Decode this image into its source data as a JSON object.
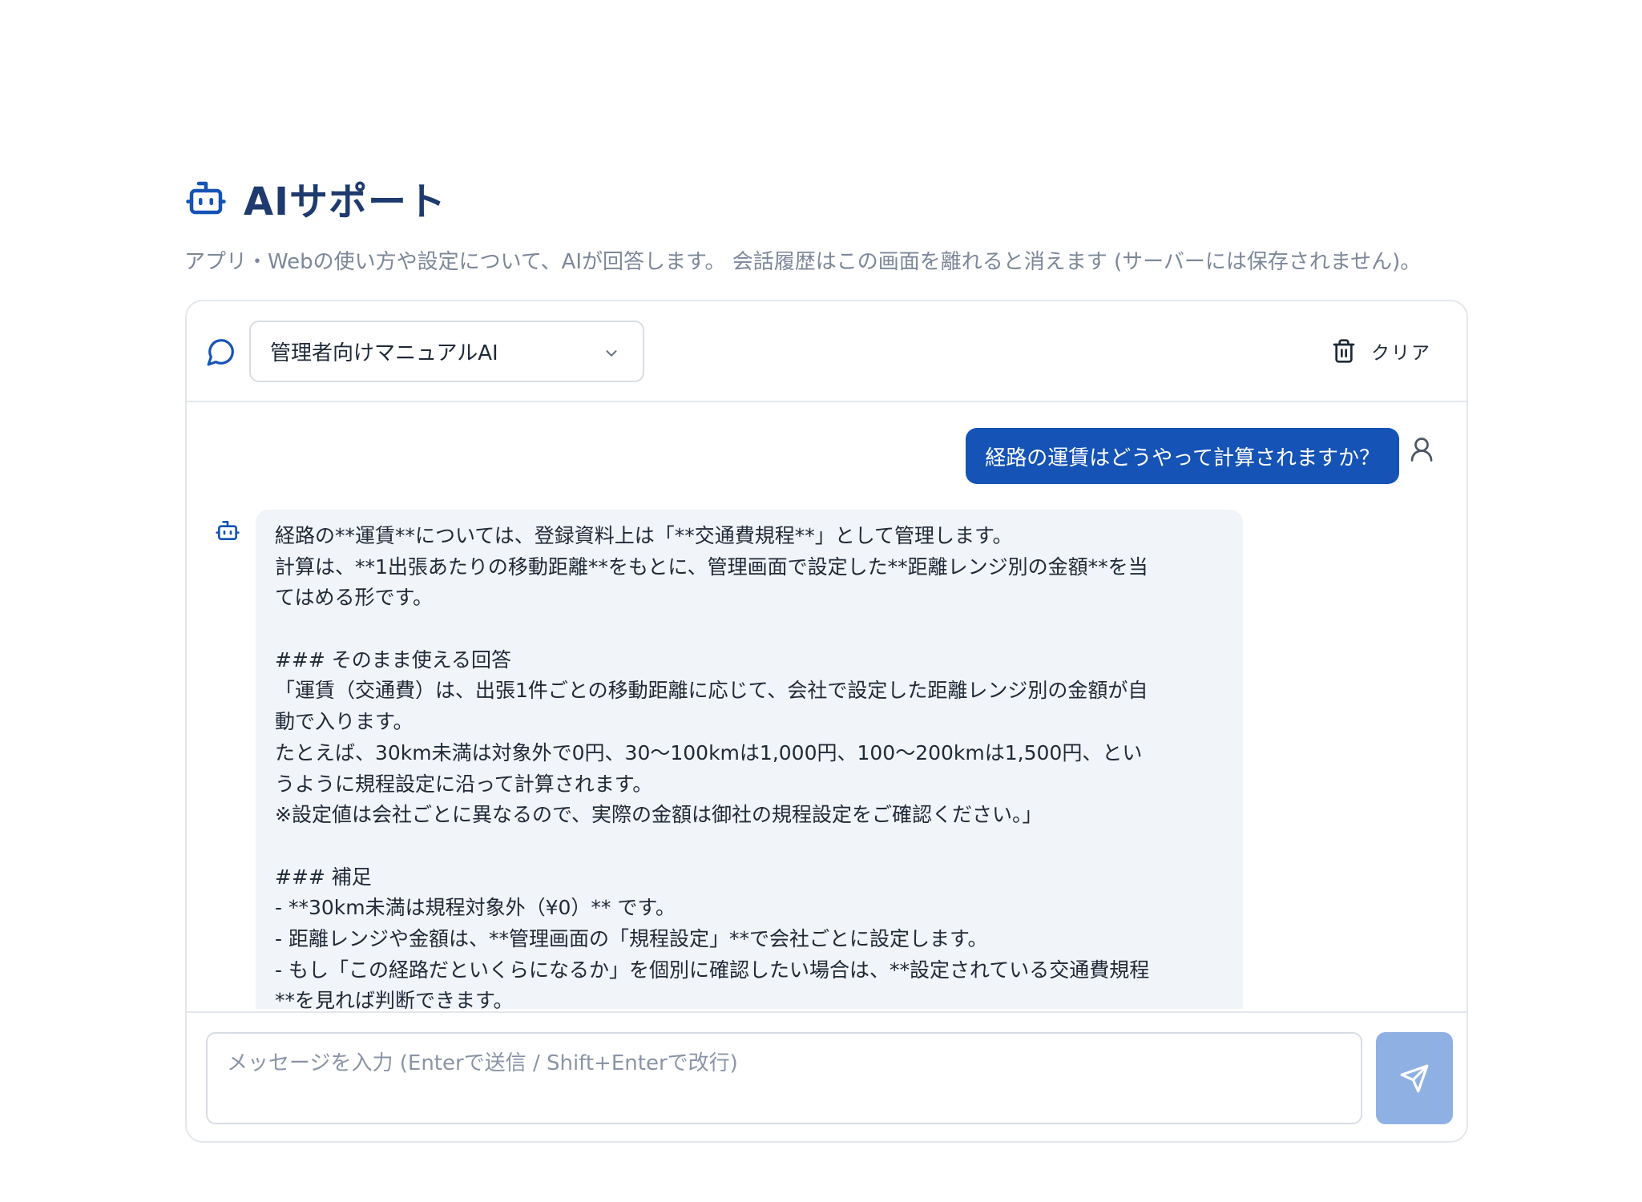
{
  "header": {
    "icon": "bot-icon",
    "title": "AIサポート",
    "subtitle": "アプリ・Webの使い方や設定について、AIが回答します。 会話履歴はこの画面を離れると消えます (サーバーには保存されません)。"
  },
  "toolbar": {
    "chat_icon": "chat-bubble-icon",
    "model_select": {
      "value": "管理者向けマニュアルAI",
      "icon": "chevron-down-icon"
    },
    "clear": {
      "label": "クリア",
      "icon": "trash-icon"
    }
  },
  "messages": {
    "user": {
      "text": "経路の運賃はどうやって計算されますか？",
      "icon": "user-icon"
    },
    "assistant": {
      "icon": "bot-icon",
      "lines": [
        "経路の**運賃**については、登録資料上は「**交通費規程**」として管理します。",
        "計算は、**1出張あたりの移動距離**をもとに、管理画面で設定した**距離レンジ別の金額**を当",
        "てはめる形です。",
        "",
        "### そのまま使える回答",
        "「運賃（交通費）は、出張1件ごとの移動距離に応じて、会社で設定した距離レンジ別の金額が自",
        "動で入ります。",
        "たとえば、30km未満は対象外で0円、30〜100kmは1,000円、100〜200kmは1,500円、とい",
        "うように規程設定に沿って計算されます。",
        "※設定値は会社ごとに異なるので、実際の金額は御社の規程設定をご確認ください。」",
        "",
        "### 補足",
        "- **30km未満は規程対象外（¥0）** です。",
        "- 距離レンジや金額は、**管理画面の「規程設定」**で会社ごとに設定します。",
        "- もし「この経路だといくらになるか」を個別に確認したい場合は、**設定されている交通費規程",
        "**を見れば判断できます。"
      ]
    }
  },
  "composer": {
    "placeholder": "メッセージを入力 (Enterで送信 / Shift+Enterで改行)",
    "send_icon": "send-icon"
  },
  "colors": {
    "accent": "#1553b6",
    "title": "#1e3a6e",
    "send_disabled": "#8fb0e2",
    "bubble_bg": "#f1f4f8"
  }
}
